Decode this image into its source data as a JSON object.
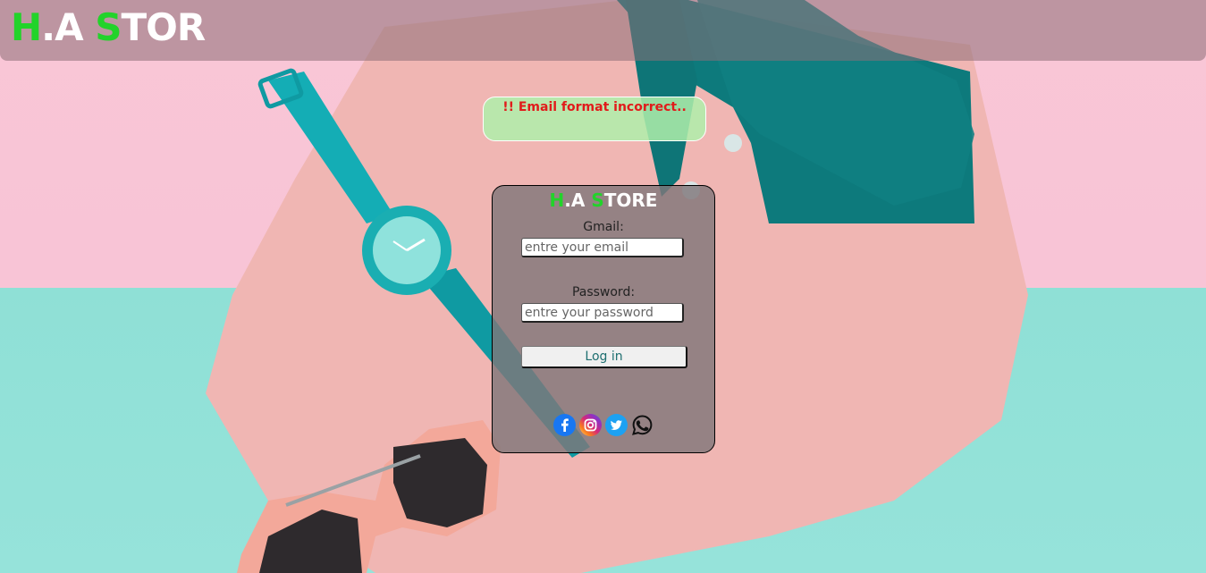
{
  "header": {
    "brand_initial_1": "H",
    "brand_mid": ".A ",
    "brand_initial_2": "S",
    "brand_rest": "TOR"
  },
  "error": {
    "message": "!! Email format incorrect.."
  },
  "login": {
    "title_initial_1": "H",
    "title_mid": ".A ",
    "title_initial_2": "S",
    "title_rest": "TORE",
    "email_label": "Gmail:",
    "email_placeholder": "entre your email",
    "email_value": "",
    "password_label": "Password:",
    "password_placeholder": "entre your password",
    "password_value": "",
    "submit_label": "Log in"
  },
  "socials": [
    {
      "name": "facebook-icon",
      "color": "#1877f2"
    },
    {
      "name": "instagram-icon",
      "color": "#d62976"
    },
    {
      "name": "twitter-icon",
      "color": "#1da1f2"
    },
    {
      "name": "whatsapp-icon",
      "color": "#111111"
    }
  ],
  "colors": {
    "brand_green": "#22d32a",
    "error_red": "#e11b1b",
    "bg_pink": "#f8c4d6",
    "bg_teal": "#92e1d8"
  }
}
